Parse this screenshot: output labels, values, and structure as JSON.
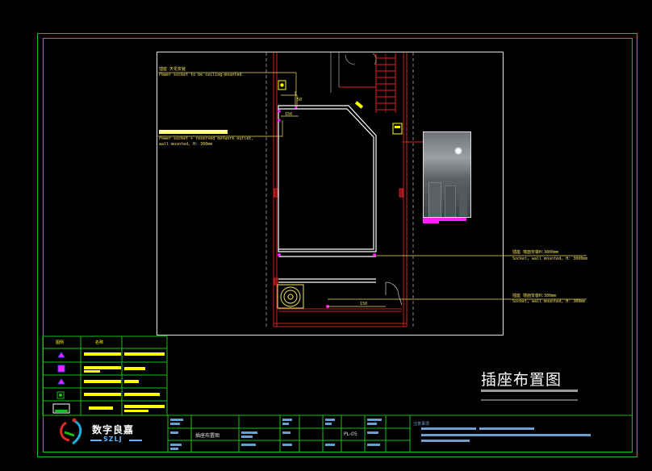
{
  "drawing": {
    "title": "插座布置图",
    "sheet_number": "PL-05",
    "titleblock_drawing_name": "插座布置图",
    "notes_header": "注意事项"
  },
  "annotations": {
    "ceiling_socket_cn": "插座 天花安装",
    "ceiling_socket_en": "Power socket to be ceiling-mounted.",
    "network_socket_en_1": "Power socket + reserved network outlet,",
    "network_socket_en_2": "wall mounted, H: 300mm",
    "socket_h3000_cn": "插座 墙面安装H:3000mm",
    "socket_h3000_en": "Socket, wall mounted, H: 3000mm",
    "socket_h300_cn": "插座 墙面安装H:300mm",
    "socket_h300_en": "Socket, wall mounted, H: 300mm",
    "dim_1": "150",
    "dim_2": "50",
    "dim_3": "150"
  },
  "legend": {
    "col_icon": "图例",
    "col_name": "名称"
  },
  "logo": {
    "name": "数字良嘉",
    "abbr": "SZLJ"
  },
  "colors": {
    "frame": "#19c019",
    "wall": "#cc2020",
    "annotation": "#f0e060",
    "highlight": "#ffff00",
    "accent_magenta": "#ff20ff"
  }
}
